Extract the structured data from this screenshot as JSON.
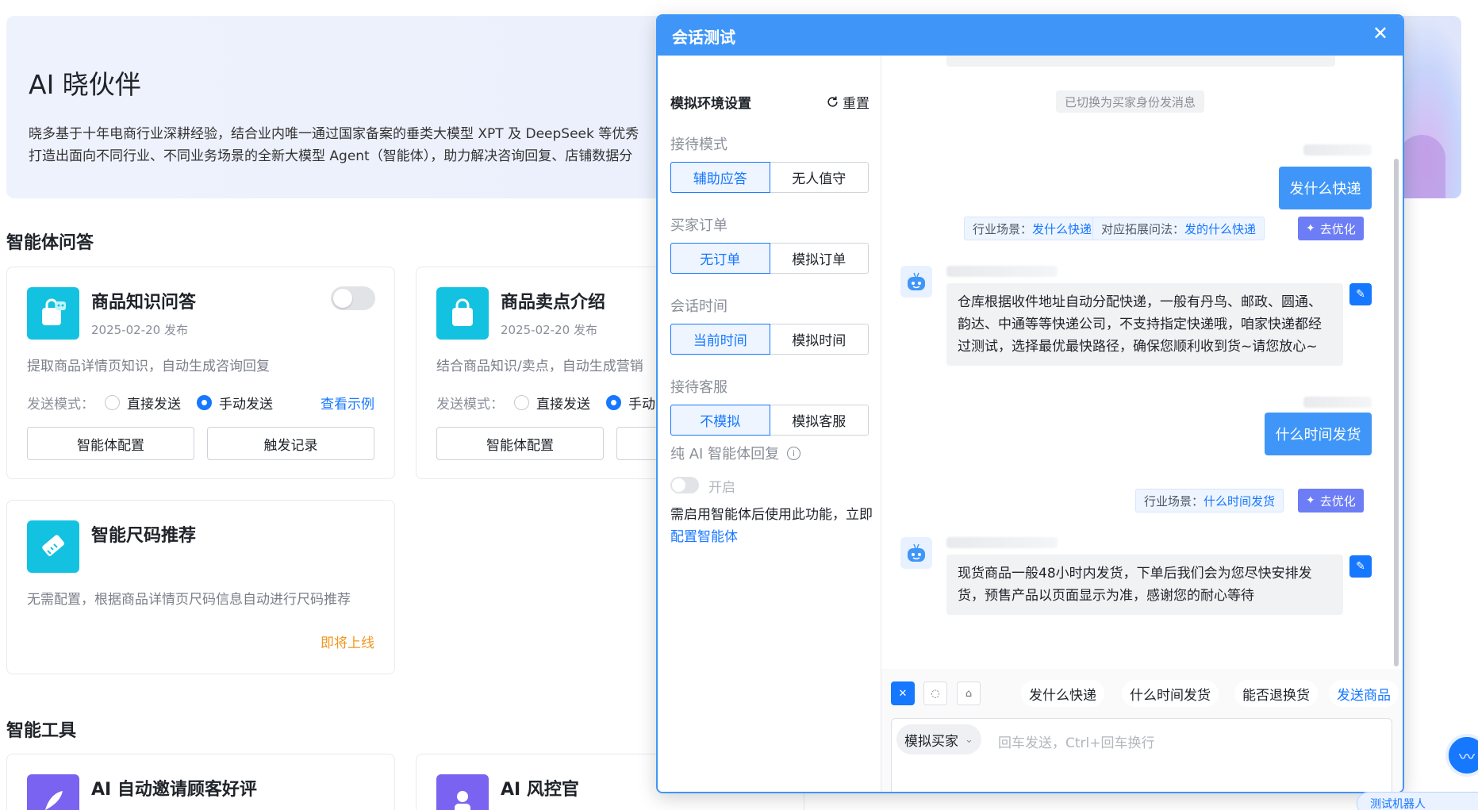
{
  "banner": {
    "title": "AI 晓伙伴",
    "desc_line1": "晓多基于十年电商行业深耕经验，结合业内唯一通过国家备案的垂类大模型 XPT 及 DeepSeek 等优秀",
    "desc_line2": "打造出面向不同行业、不同业务场景的全新大模型 Agent（智能体），助力解决咨询回复、店铺数据分"
  },
  "sections": {
    "agents_qa": "智能体问答",
    "tools": "智能工具"
  },
  "cards": {
    "knowledge": {
      "title": "商品知识问答",
      "date": "2025-02-20 发布",
      "desc": "提取商品详情页知识，自动生成咨询回复",
      "send_mode_label": "发送模式：",
      "opt_direct": "直接发送",
      "opt_manual": "手动发送",
      "example_link": "查看示例",
      "config_btn": "智能体配置",
      "record_btn": "触发记录"
    },
    "selling": {
      "title": "商品卖点介绍",
      "date": "2025-02-20 发布",
      "desc": "结合商品知识/卖点，自动生成营销",
      "send_mode_label": "发送模式：",
      "opt_direct": "直接发送",
      "opt_manual": "手动",
      "config_btn": "智能体配置"
    },
    "size": {
      "title": "智能尺码推荐",
      "desc": "无需配置，根据商品详情页尺码信息自动进行尺码推荐",
      "coming": "即将上线"
    },
    "review": {
      "title": "AI 自动邀请顾客好评"
    },
    "risk": {
      "title": "AI 风控官"
    }
  },
  "modal": {
    "title": "会话测试",
    "close": "✕",
    "settings": {
      "title": "模拟环境设置",
      "reset": "重置",
      "reception_mode": {
        "label": "接待模式",
        "options": [
          "辅助应答",
          "无人值守"
        ],
        "active": 0
      },
      "buyer_order": {
        "label": "买家订单",
        "options": [
          "无订单",
          "模拟订单"
        ],
        "active": 0
      },
      "session_time": {
        "label": "会话时间",
        "options": [
          "当前时间",
          "模拟时间"
        ],
        "active": 0
      },
      "reception_staff": {
        "label": "接待客服",
        "options": [
          "不模拟",
          "模拟客服"
        ],
        "active": 0
      },
      "pure_ai_label": "纯 AI 智能体回复",
      "pure_ai_toggle": "开启",
      "hint_text": "需启用智能体后使用此功能，立即",
      "hint_link": "配置智能体"
    },
    "chat": {
      "system_msg": "已切换为买家身份发消息",
      "msg1_user": "发什么快递",
      "msg1_tag_scene_label": "行业场景：",
      "msg1_tag_scene_value": "发什么快递",
      "msg1_tag_ext_label": "对应拓展问法：",
      "msg1_tag_ext_value": "发的什么快递",
      "optimize": "去优化",
      "msg1_bot": "仓库根据收件地址自动分配快递，一般有丹鸟、邮政、圆通、韵达、中通等等快递公司，不支持指定快递哦，咱家快递都经过测试，选择最优最快路径，确保您顺利收到货~请您放心~",
      "msg2_user": "什么时间发货",
      "msg2_tag_scene_label": "行业场景：",
      "msg2_tag_scene_value": "什么时间发货",
      "msg2_bot": "现货商品一般48小时内发货，下单后我们会为您尽快安排发货，预售产品以页面显示为准，感谢您的耐心等待"
    },
    "quick_replies": [
      "发什么快递",
      "什么时间发货",
      "能否退换货"
    ],
    "send_product": "发送商品",
    "buyer_select": "模拟买家",
    "input_placeholder": "回车发送，Ctrl+回车换行"
  },
  "float_pill": "测试机器人",
  "colors": {
    "primary": "#1677ff",
    "header": "#3f96f8",
    "optimize": "#6c7df5",
    "coming": "#f0961e"
  }
}
